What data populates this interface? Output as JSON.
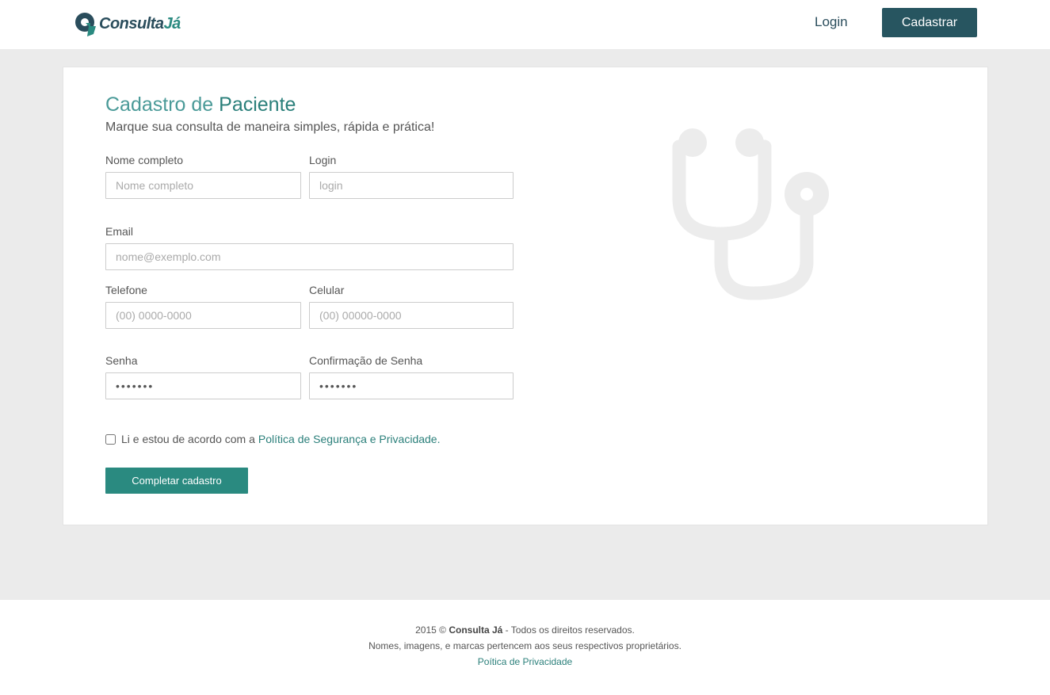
{
  "header": {
    "logo_main": "Consulta",
    "logo_accent": "Já",
    "login_label": "Login",
    "register_label": "Cadastrar"
  },
  "form": {
    "title_part1": "Cadastro de ",
    "title_part2": "Paciente",
    "subtitle": "Marque sua consulta de maneira simples, rápida e prática!",
    "fields": {
      "nome": {
        "label": "Nome completo",
        "placeholder": "Nome completo"
      },
      "login": {
        "label": "Login",
        "placeholder": "login"
      },
      "email": {
        "label": "Email",
        "placeholder": "nome@exemplo.com"
      },
      "telefone": {
        "label": "Telefone",
        "placeholder": "(00) 0000-0000"
      },
      "celular": {
        "label": "Celular",
        "placeholder": "(00) 00000-0000"
      },
      "senha": {
        "label": "Senha",
        "value": "1234567"
      },
      "confirmacao": {
        "label": "Confirmação de Senha",
        "value": "1234567"
      }
    },
    "agree_text": "Li e estou de acordo com a",
    "agree_link": "Política de Segurança e Privacidade.",
    "agree_checked": false,
    "submit_label": "Completar cadastro"
  },
  "footer": {
    "copy_prefix": "2015 © ",
    "brand": "Consulta Já",
    "copy_suffix": " - Todos os direitos reservados.",
    "line2": "Nomes, imagens, e marcas pertencem aos seus respectivos proprietários.",
    "privacy_link": "Poítica de Privacidade"
  },
  "icons": {
    "logo": "consultaja-logo-icon",
    "illustration": "stethoscope-icon"
  },
  "colors": {
    "brand_dark": "#275560",
    "brand_teal": "#2a8a80",
    "background": "#ebebeb"
  }
}
